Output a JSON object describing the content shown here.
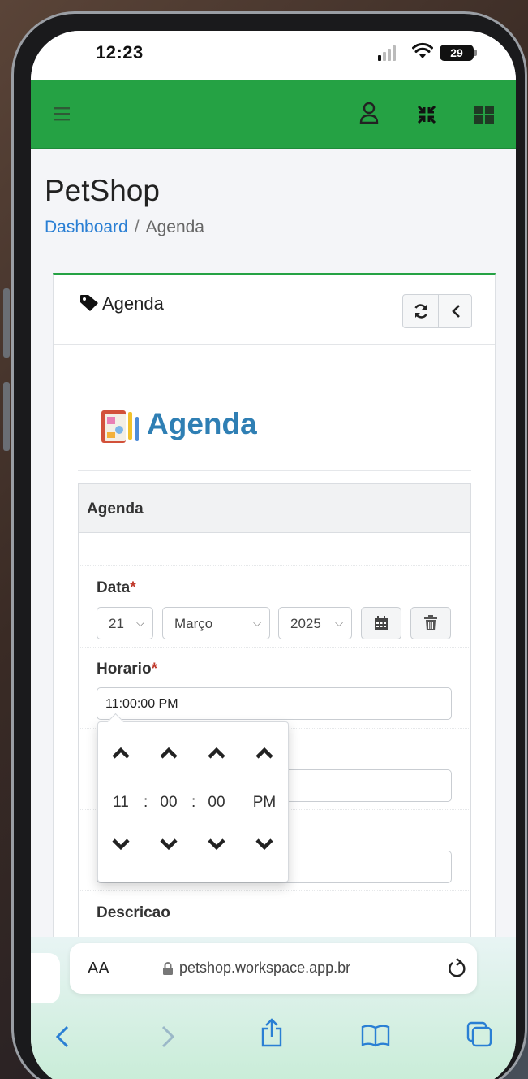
{
  "status": {
    "time": "12:23",
    "battery": "29"
  },
  "page": {
    "title": "PetShop"
  },
  "breadcrumb": {
    "home": "Dashboard",
    "separator": "/",
    "current": "Agenda"
  },
  "card": {
    "title": "Agenda"
  },
  "heading": {
    "title": "Agenda"
  },
  "panel": {
    "title": "Agenda"
  },
  "form": {
    "data_label": "Data",
    "required_mark": "*",
    "day": "21",
    "month": "Março",
    "year": "2025",
    "horario_label": "Horario",
    "horario_value": "11:00:00 PM",
    "descricao_label": "Descricao"
  },
  "timepicker": {
    "hour": "11",
    "minute": "00",
    "second": "00",
    "meridian": "PM",
    "separator": ":"
  },
  "browser": {
    "text_size": "AA",
    "url": "petshop.workspace.app.br"
  },
  "colors": {
    "accent": "#25a244",
    "link": "#2a7fd4",
    "heading": "#2f7fb4",
    "required": "#c0392b"
  },
  "icons": [
    "menu-icon",
    "user-icon",
    "compress-icon",
    "grid-icon",
    "tag-icon",
    "refresh-icon",
    "back-icon",
    "calendar-icon",
    "trash-icon",
    "chevron-up-icon",
    "chevron-down-icon",
    "lock-icon",
    "reload-icon",
    "share-icon",
    "bookmarks-icon",
    "tabs-icon"
  ]
}
